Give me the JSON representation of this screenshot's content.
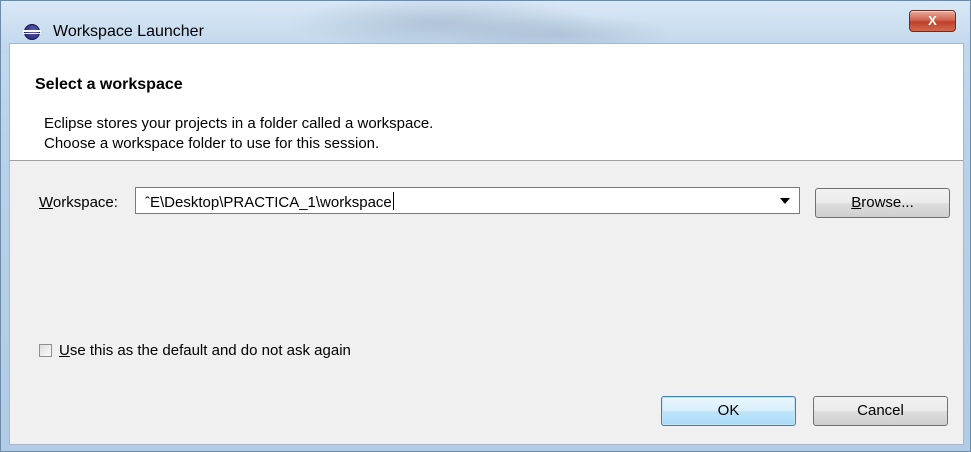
{
  "window": {
    "title": "Workspace Launcher",
    "close_label": "X"
  },
  "banner": {
    "title": "Select a workspace",
    "message_line1": "Eclipse stores your projects in a folder called a workspace.",
    "message_line2": "Choose a workspace folder to use for this session."
  },
  "workspace": {
    "label_mnemonic": "W",
    "label_rest": "orkspace:",
    "value": "ˆE\\Desktop\\PRACTICA_1\\workspace"
  },
  "browse_button": {
    "mnemonic": "B",
    "rest": "rowse..."
  },
  "default_checkbox": {
    "mnemonic": "U",
    "rest": "se this as the default and do not ask again",
    "checked": false
  },
  "buttons": {
    "ok": "OK",
    "cancel": "Cancel"
  },
  "icons": {
    "app": "eclipse-icon",
    "combo": "dropdown-arrow-icon"
  }
}
